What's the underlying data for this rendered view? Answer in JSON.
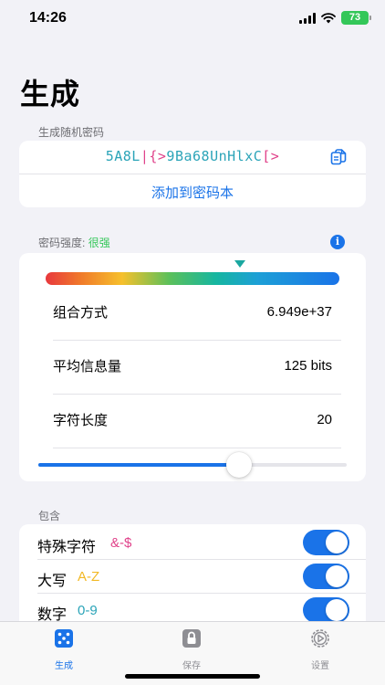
{
  "status_bar": {
    "time": "14:26",
    "battery": "73"
  },
  "page_title": "生成",
  "password_section": {
    "label": "生成随机密码",
    "chars": [
      {
        "c": "5",
        "color": "#2ba4b8"
      },
      {
        "c": "A",
        "color": "#2ba4b8"
      },
      {
        "c": "8",
        "color": "#2ba4b8"
      },
      {
        "c": "L",
        "color": "#2ba4b8"
      },
      {
        "c": "|",
        "color": "#e0428a"
      },
      {
        "c": "{",
        "color": "#e0428a"
      },
      {
        "c": ">",
        "color": "#e0428a"
      },
      {
        "c": "9",
        "color": "#2ba4b8"
      },
      {
        "c": "B",
        "color": "#2ba4b8"
      },
      {
        "c": "a",
        "color": "#2ba4b8"
      },
      {
        "c": "6",
        "color": "#2ba4b8"
      },
      {
        "c": "8",
        "color": "#2ba4b8"
      },
      {
        "c": "U",
        "color": "#2ba4b8"
      },
      {
        "c": "n",
        "color": "#2ba4b8"
      },
      {
        "c": "H",
        "color": "#2ba4b8"
      },
      {
        "c": "l",
        "color": "#2ba4b8"
      },
      {
        "c": "x",
        "color": "#2ba4b8"
      },
      {
        "c": "C",
        "color": "#2ba4b8"
      },
      {
        "c": "[",
        "color": "#e0428a"
      },
      {
        "c": ">",
        "color": "#e0428a"
      }
    ],
    "add_button": "添加到密码本"
  },
  "strength": {
    "label": "密码强度:",
    "value": "很强",
    "info_icon": "i",
    "level_fraction": 0.66,
    "rows": [
      {
        "label": "组合方式",
        "value": "6.949e+37"
      },
      {
        "label": "平均信息量",
        "value": "125 bits"
      },
      {
        "label": "字符长度",
        "value": "20"
      }
    ],
    "slider_fraction": 0.65
  },
  "include": {
    "label": "包含",
    "options": [
      {
        "name": "特殊字符",
        "chars": "&-$",
        "color": "#e0428a",
        "on": true
      },
      {
        "name": "大写",
        "chars": "A-Z",
        "color": "#f2b824",
        "on": true
      },
      {
        "name": "数字",
        "chars": "0-9",
        "color": "#2ba4b8",
        "on": true
      }
    ]
  },
  "tabs": [
    {
      "label": "生成",
      "icon": "dice-icon",
      "active": true
    },
    {
      "label": "保存",
      "icon": "lock-icon",
      "active": false
    },
    {
      "label": "设置",
      "icon": "gear-icon",
      "active": false
    }
  ],
  "colors": {
    "accent": "#1a73e8",
    "strong": "#34c759",
    "special": "#e0428a",
    "alnum": "#2ba4b8",
    "upper": "#f2b824"
  }
}
